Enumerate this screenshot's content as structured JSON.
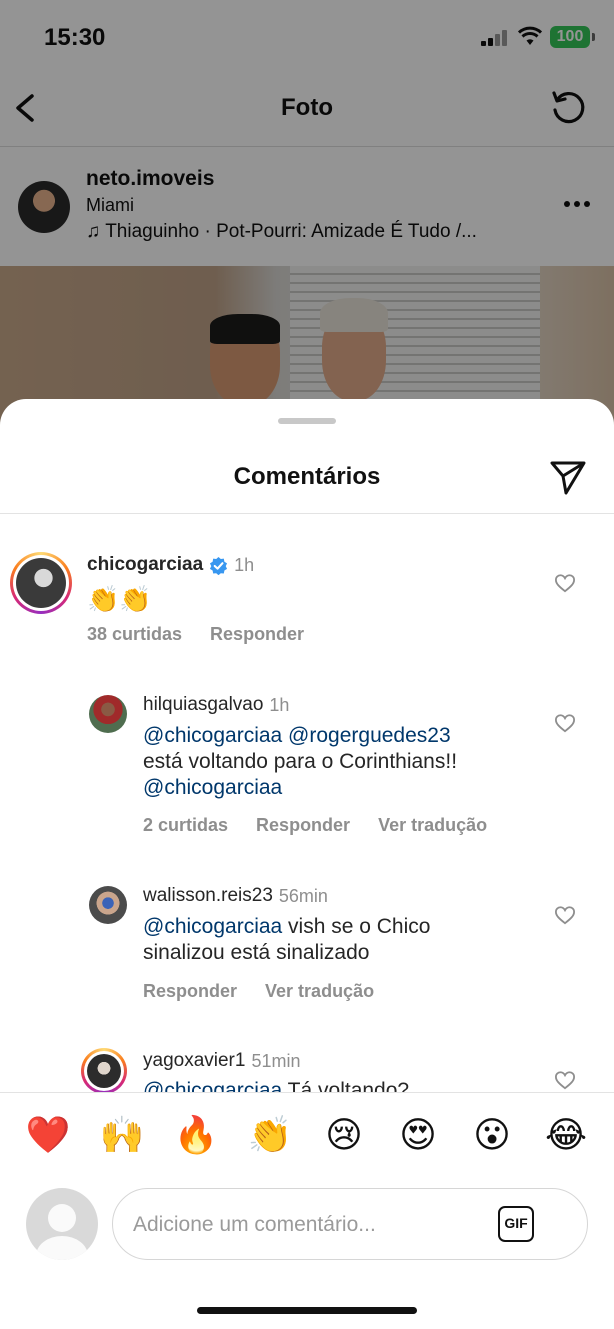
{
  "status_bar": {
    "time": "15:30",
    "battery": "100"
  },
  "nav": {
    "title": "Foto"
  },
  "post": {
    "username": "neto.imoveis",
    "location": "Miami",
    "music": "Thiaguinho · Pot-Pourri: Amizade É Tudo /..."
  },
  "sheet": {
    "title": "Comentários"
  },
  "comments": [
    {
      "username": "chicogarciaa",
      "verified": true,
      "time": "1h",
      "text": "👏👏",
      "likes": "38 curtidas",
      "reply": "Responder"
    },
    {
      "username": "hilquiasgalvao",
      "time": "1h",
      "lines": [
        {
          "mention": "@chicogarciaa @rogerguedes23",
          "text": ""
        },
        {
          "mention": "",
          "text": "está voltando para o Corinthians!!"
        },
        {
          "mention": "@chicogarciaa",
          "text": ""
        }
      ],
      "likes": "2 curtidas",
      "reply": "Responder",
      "translate": "Ver tradução"
    },
    {
      "username": "walisson.reis23",
      "time": "56min",
      "lines": [
        {
          "mention": "@chicogarciaa",
          "text": " vish se o Chico"
        },
        {
          "mention": "",
          "text": "sinalizou está sinalizado"
        }
      ],
      "reply": "Responder",
      "translate": "Ver tradução"
    },
    {
      "username": "yagoxavier1",
      "time": "51min",
      "lines": [
        {
          "mention": "@chicogarciaa",
          "text": " Tá voltando?"
        }
      ]
    }
  ],
  "emoji_bar": [
    "❤️",
    "🙌",
    "🔥",
    "👏",
    "😢",
    "😍",
    "😮",
    "😂"
  ],
  "comment_input": {
    "placeholder": "Adicione um comentário...",
    "gif_label": "GIF"
  },
  "colors": {
    "mention": "#00376b",
    "muted": "#8e8e8e",
    "verified": "#3897f0"
  }
}
